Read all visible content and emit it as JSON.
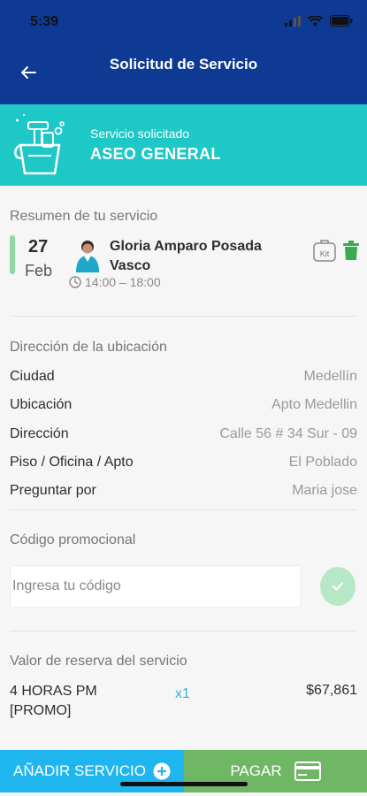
{
  "status_bar": {
    "time": "5:39"
  },
  "header": {
    "title": "Solicitud de Servicio"
  },
  "service": {
    "subtitle": "Servicio solicitado",
    "name": "ASEO GENERAL"
  },
  "summary": {
    "section_title": "Resumen de tu servicio",
    "day": "27",
    "month": "Feb",
    "worker_name": "Gloria Amparo Posada Vasco",
    "time_range": "14:00 – 18:00",
    "kit_label": "Kit"
  },
  "location": {
    "section_title": "Dirección de la ubicación",
    "rows": [
      {
        "label": "Ciudad",
        "value": "Medellín"
      },
      {
        "label": "Ubicación",
        "value": "Apto Medellin"
      },
      {
        "label": "Dirección",
        "value": "Calle 56 # 34 Sur - 09"
      },
      {
        "label": "Piso / Oficina / Apto",
        "value": "El Poblado"
      },
      {
        "label": "Preguntar por",
        "value": "Maria jose"
      }
    ]
  },
  "promo": {
    "section_title": "Código promocional",
    "placeholder": "Ingresa tu código",
    "value": ""
  },
  "booking": {
    "section_title": "Valor de reserva del servicio",
    "item_name": "4 HORAS PM [PROMO]",
    "quantity": "x1",
    "price": "$67,861"
  },
  "actions": {
    "add_label": "AÑADIR SERVICIO",
    "pay_label": "PAGAR"
  },
  "colors": {
    "header": "#0f3a93",
    "band": "#1dc8c6",
    "add": "#1fb6f0",
    "pay": "#6fb765",
    "trash": "#3caa4f",
    "qty": "#2fb6d9"
  }
}
